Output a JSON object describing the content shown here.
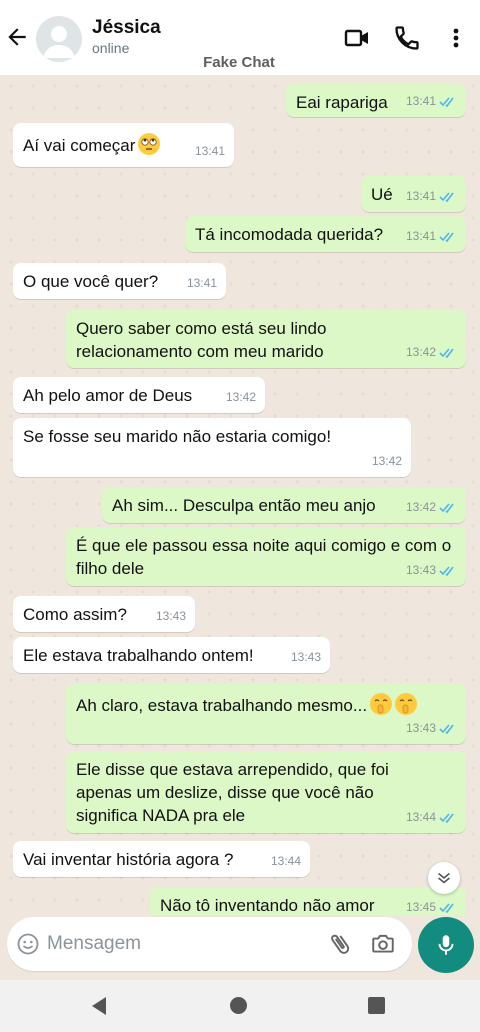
{
  "header": {
    "contact_name": "Jéssica",
    "status": "online",
    "watermark": "Fake Chat",
    "icons": [
      "back-arrow-icon",
      "avatar-placeholder-icon",
      "video-call-icon",
      "phone-icon",
      "more-options-icon"
    ]
  },
  "messages": [
    {
      "dir": "out",
      "text": "Eai rapariga",
      "time": "13:41",
      "ticks": "read"
    },
    {
      "dir": "in",
      "text": "Aí vai começar",
      "emoji": "rolling-eyes-emoji",
      "time": "13:41"
    },
    {
      "dir": "out",
      "text": "Ué",
      "time": "13:41",
      "ticks": "read"
    },
    {
      "dir": "out",
      "text": "Tá incomodada querida?",
      "time": "13:41",
      "ticks": "read"
    },
    {
      "dir": "in",
      "text": "O que você quer?",
      "time": "13:41"
    },
    {
      "dir": "out",
      "text": "Quero saber como está seu lindo relacionamento com meu marido",
      "time": "13:42",
      "ticks": "read"
    },
    {
      "dir": "in",
      "text": "Ah pelo amor de Deus",
      "time": "13:42"
    },
    {
      "dir": "in",
      "text": "Se fosse seu marido não estaria comigo!",
      "time": "13:42"
    },
    {
      "dir": "out",
      "text": "Ah sim... Desculpa então meu anjo",
      "time": "13:42",
      "ticks": "read"
    },
    {
      "dir": "out",
      "text": "É que ele passou essa noite aqui comigo e com o filho dele",
      "time": "13:43",
      "ticks": "read"
    },
    {
      "dir": "in",
      "text": "Como assim?",
      "time": "13:43"
    },
    {
      "dir": "in",
      "text": "Ele estava trabalhando ontem!",
      "time": "13:43"
    },
    {
      "dir": "out",
      "text": "Ah claro, estava trabalhando mesmo...",
      "emoji": "shushing-face-emoji x2",
      "time": "13:43",
      "ticks": "read"
    },
    {
      "dir": "out",
      "text": "Ele disse que estava arrependido, que foi apenas um deslize, disse que você não significa NADA pra ele",
      "time": "13:44",
      "ticks": "read"
    },
    {
      "dir": "in",
      "text": "Vai inventar história agora ?",
      "time": "13:44"
    },
    {
      "dir": "out",
      "text": "Não tô inventando não amor",
      "time": "13:45",
      "ticks": "read"
    }
  ],
  "composer": {
    "placeholder": "Mensagem",
    "icons": [
      "emoji-icon",
      "attach-clip-icon",
      "camera-icon",
      "mic-icon"
    ]
  },
  "colors": {
    "outgoing_bubble": "#dcf8c6",
    "incoming_bubble": "#ffffff",
    "read_tick": "#4fb6ec",
    "mic_button": "#128c7e",
    "chat_background": "#efe7de"
  }
}
